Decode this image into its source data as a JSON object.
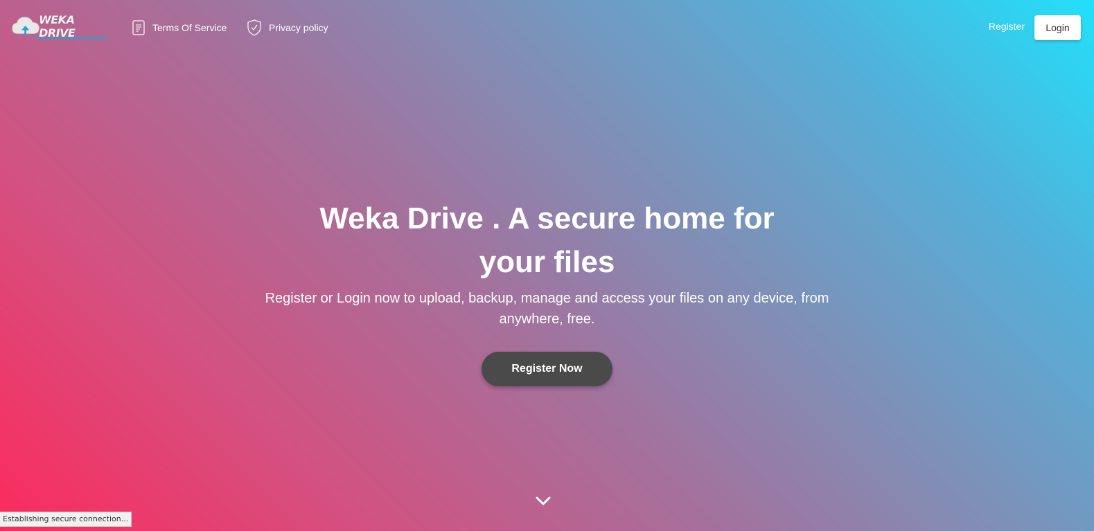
{
  "navbar": {
    "logo_text": "WEKA DRIVE",
    "links": {
      "terms": "Terms Of Service",
      "privacy": "Privacy policy"
    },
    "register_label": "Register",
    "login_label": "Login"
  },
  "hero": {
    "title": "Weka Drive . A secure home for your files",
    "subtitle": "Register or Login now to upload, backup, manage and access your files on any device, from anywhere, free.",
    "cta_label": "Register Now"
  },
  "status_bar": {
    "text": "Establishing secure connection..."
  },
  "colors": {
    "gradient_start": "#fc2a5c",
    "gradient_end": "#22e0fa",
    "cta_background": "#4a4a4a",
    "login_background": "#ffffff"
  },
  "icons": {
    "logo": "cloud-upload-icon",
    "terms": "document-icon",
    "privacy": "shield-check-icon",
    "scroll": "chevron-down-icon"
  }
}
